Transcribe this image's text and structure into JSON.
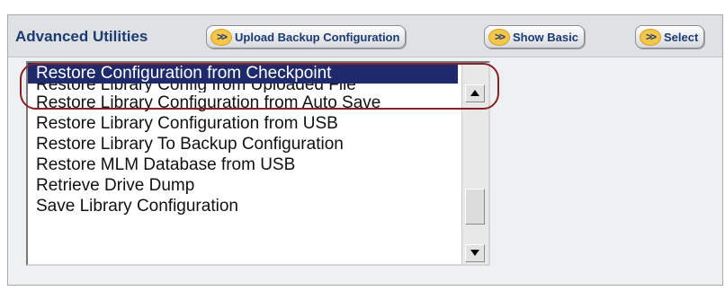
{
  "header": {
    "title": "Advanced Utilities",
    "buttons": [
      {
        "label": "Upload Backup Configuration",
        "icon": "double-chevron-right-icon"
      },
      {
        "label": "Show Basic",
        "icon": "double-chevron-right-icon"
      },
      {
        "label": "Select",
        "icon": "double-chevron-right-icon"
      }
    ]
  },
  "utilities_list": {
    "selected_index": 0,
    "items": [
      "Restore Configuration from Checkpoint",
      "Restore Library Config from Uploaded File",
      "Restore Library Configuration from Auto Save",
      "Restore Library Configuration from USB",
      "Restore Library To Backup Configuration",
      "Restore MLM Database from USB",
      "Retrieve Drive Dump",
      "Save Library Configuration"
    ]
  },
  "colors": {
    "title_text": "#1b3b73",
    "selection_bg": "#1f2a6d",
    "highlight_ring": "#8a2027",
    "button_icon": "#f4c74a"
  }
}
